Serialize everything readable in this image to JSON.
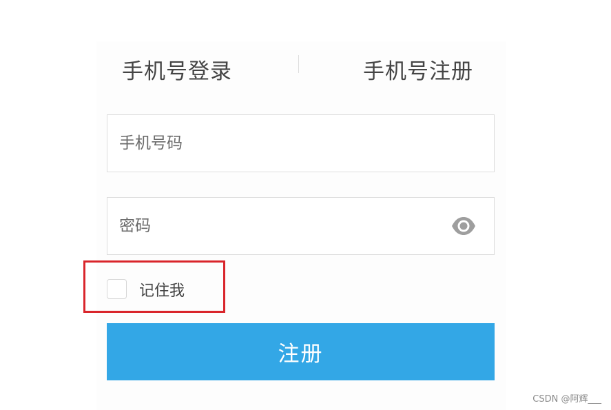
{
  "tabs": {
    "login_label": "手机号登录",
    "register_label": "手机号注册"
  },
  "form": {
    "phone_placeholder": "手机号码",
    "phone_value": "",
    "password_placeholder": "密码",
    "password_value": "",
    "remember_label": "记住我",
    "remember_checked": false,
    "submit_label": "注册"
  },
  "icons": {
    "password_toggle": "eye-icon"
  },
  "colors": {
    "primary_button": "#33a7e6",
    "highlight_border": "#d9252b"
  },
  "watermark": "CSDN @阿辉___"
}
